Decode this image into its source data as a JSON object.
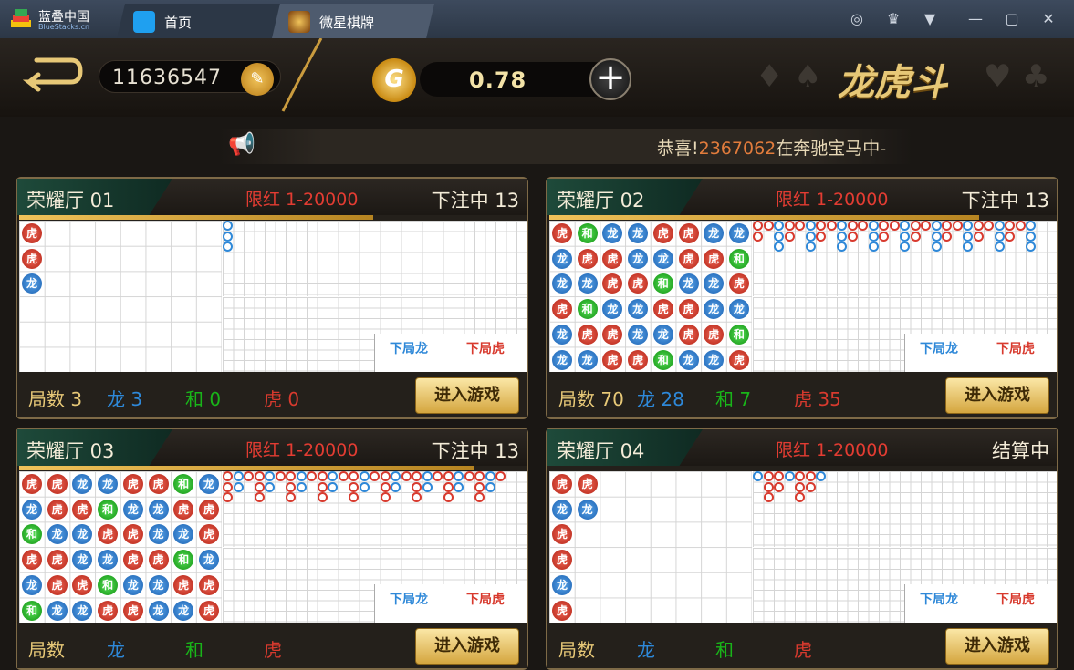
{
  "window": {
    "app_name": "蓝叠中国",
    "app_sub": "BlueStacks.cn",
    "tabs": [
      {
        "label": "首页"
      },
      {
        "label": "微星棋牌"
      }
    ]
  },
  "header": {
    "user_id": "11636547",
    "balance": "0.78",
    "coin_symbol": "G",
    "game_title": "龙虎斗"
  },
  "ticker": {
    "prefix": "恭喜!",
    "number": "2367062",
    "mid": "在",
    "game": "奔驰宝马",
    "suffix": "中-"
  },
  "labels": {
    "next_long": "下局龙",
    "next_hu": "下局虎",
    "enter": "进入游戏",
    "rounds": "局数",
    "long": "龙",
    "he": "和",
    "hu": "虎",
    "bead_long": "龙",
    "bead_hu": "虎",
    "bead_he": "和"
  },
  "rooms": [
    {
      "name": "荣耀厅 01",
      "limit": "限红 1-20000",
      "status": "下注中 13",
      "rounds": "3",
      "long": "3",
      "he": "0",
      "hu": "0",
      "progress": 0.7
    },
    {
      "name": "荣耀厅 02",
      "limit": "限红 1-20000",
      "status": "下注中 13",
      "rounds": "70",
      "long": "28",
      "he": "7",
      "hu": "35",
      "progress": 0.85
    },
    {
      "name": "荣耀厅 03",
      "limit": "限红 1-20000",
      "status": "下注中 13",
      "rounds": "",
      "long": "",
      "he": "",
      "hu": "",
      "progress": 0.9
    },
    {
      "name": "荣耀厅 04",
      "limit": "限红 1-20000",
      "status": "结算中",
      "rounds": "",
      "long": "",
      "he": "",
      "hu": "",
      "progress": 0
    }
  ],
  "colors": {
    "long": "#2e88d8",
    "hu": "#d83a2e",
    "he": "#19b519",
    "gold": "#e7c877"
  }
}
